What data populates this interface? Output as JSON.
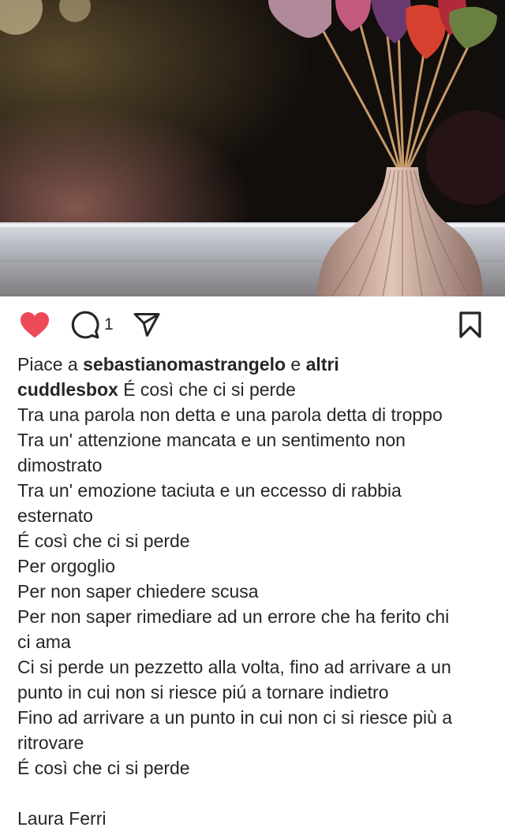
{
  "post": {
    "likes": {
      "prefix": "Piace a",
      "user": "sebastianomastrangelo",
      "joiner": "e",
      "others": "altri"
    },
    "comment_count": "1",
    "caption": {
      "username": "cuddlesbox",
      "first_line": " É così che ci si perde",
      "lines": [
        "Tra una parola non detta e una parola detta di troppo",
        "Tra un' attenzione mancata e un sentimento non",
        "dimostrato",
        "Tra un' emozione taciuta e un eccesso di rabbia",
        "esternato",
        "É così che ci si perde",
        "Per orgoglio",
        "Per non saper chiedere scusa",
        "Per non saper rimediare ad un errore che ha ferito chi",
        "ci ama",
        "Ci si perde un pezzetto alla volta, fino ad arrivare a un",
        "punto in cui non si riesce piú a tornare indietro",
        "Fino ad arrivare a un punto in cui non ci si riesce più a",
        "ritrovare",
        "É così che ci si perde",
        "",
        "Laura Ferri"
      ]
    }
  },
  "icons": {
    "like": "heart-icon",
    "comment": "comment-icon",
    "share": "send-icon",
    "save": "bookmark-icon"
  },
  "colors": {
    "like_active": "#ed4956",
    "icon": "#262626",
    "text": "#262626"
  }
}
